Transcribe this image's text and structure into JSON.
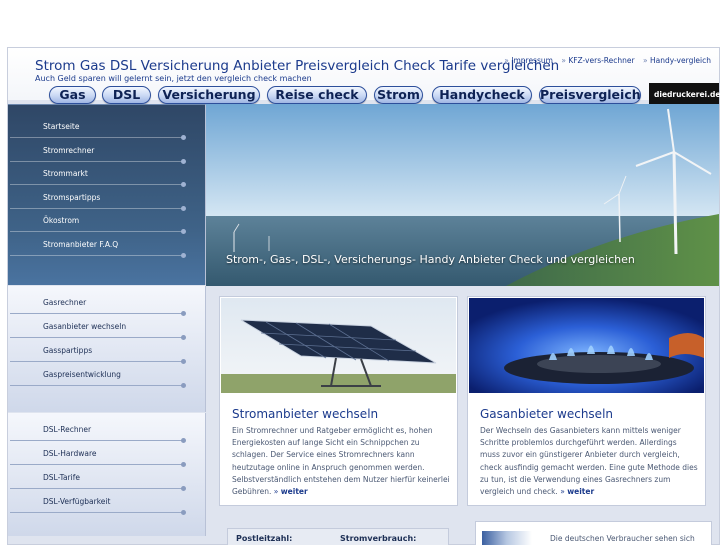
{
  "header": {
    "title": "Strom Gas DSL Versicherung Anbieter Preisvergleich Check Tarife vergleichen",
    "subtitle": "Auch Geld sparen will gelernt sein, jetzt den vergleich check machen",
    "toplinks": [
      "Impressum",
      "KFZ-vers-Rechner",
      "Handy-vergleich"
    ]
  },
  "tabs": [
    "Gas",
    "DSL",
    "Versicherung",
    "Reise check",
    "Strom",
    "Handycheck",
    "Preisvergleich"
  ],
  "ad": {
    "label": "diedruckerei.de"
  },
  "nav": {
    "strom": [
      "Startseite",
      "Stromrechner",
      "Strommarkt",
      "Stromspartipps",
      "Ökostrom",
      "Stromanbieter F.A.Q"
    ],
    "gas": [
      "Gasrechner",
      "Gasanbieter wechseln",
      "Gasspartipps",
      "Gaspreisentwicklung"
    ],
    "dsl": [
      "DSL-Rechner",
      "DSL-Hardware",
      "DSL-Tarife",
      "DSL-Verfügbarkeit"
    ]
  },
  "hero": {
    "text": "Strom-, Gas-, DSL-, Versicherungs- Handy Anbieter Check und vergleichen"
  },
  "cards": [
    {
      "title": "Stromanbieter wechseln",
      "text": "Ein Stromrechner und Ratgeber ermöglicht es, hohen Energiekosten auf lange Sicht ein Schnippchen zu schlagen. Der Service eines Stromrechners kann heutzutage online in Anspruch genommen werden. Selbstverständlich entstehen dem Nutzer hierfür keinerlei Gebühren.",
      "more": "weiter"
    },
    {
      "title": "Gasanbieter wechseln",
      "text": "Der Wechseln des Gasanbieters kann mittels weniger Schritte problemlos durchgeführt werden. Allerdings muss zuvor ein günstigerer Anbieter durch vergleich, check ausfindig gemacht werden. Eine gute Methode dies zu tun, ist die Verwendung eines Gasrechners zum vergleich und check.",
      "more": "weiter"
    }
  ],
  "calculator": {
    "postcode_label": "Postleitzahl:",
    "consumption_label": "Stromverbrauch:"
  },
  "promo": {
    "text": "Die deutschen Verbraucher sehen sich"
  },
  "colors": {
    "accent": "#1b3a8c",
    "nav_dark": "#2f4766",
    "page_bg": "#dfe4ef"
  }
}
